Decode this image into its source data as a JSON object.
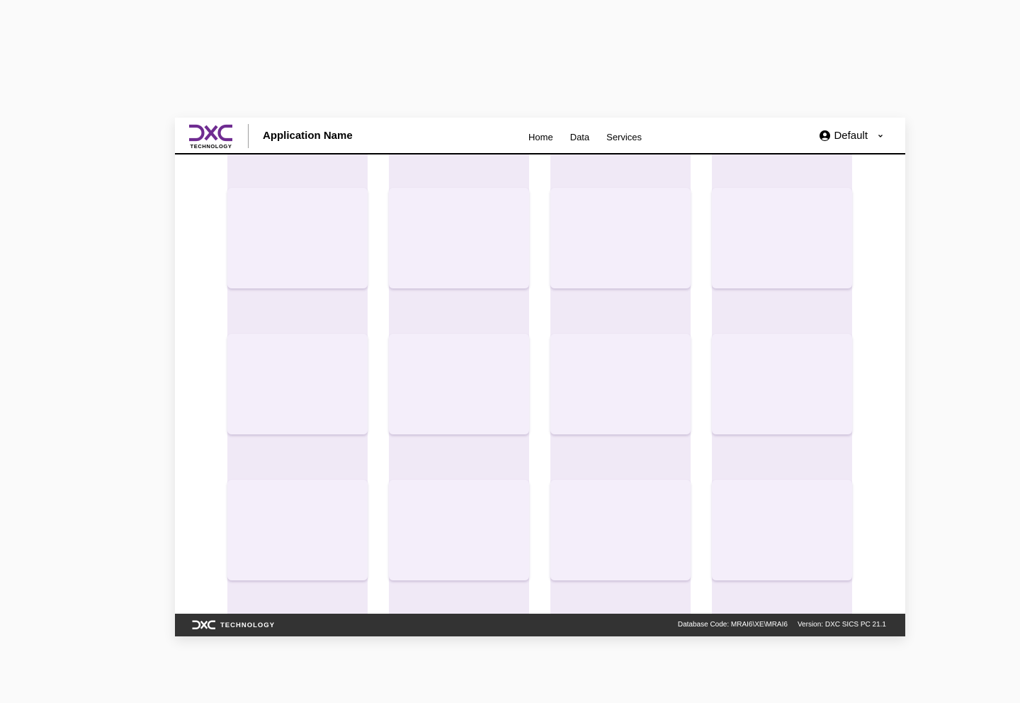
{
  "header": {
    "logo_text": "TECHNOLOGY",
    "app_name": "Application Name",
    "nav": [
      "Home",
      "Data",
      "Services"
    ],
    "user_label": "Default"
  },
  "footer": {
    "logo_text": "TECHNOLOGY",
    "database_code": "Database Code: MRAI6\\XE\\MRAI6",
    "version": "Version: DXC SICS PC 21.1"
  },
  "colors": {
    "brand_purple": "#6f2c91",
    "footer_bg": "#333333",
    "column_bg": "#f0e9f6",
    "card_bg": "#f4eefa"
  },
  "icons": {
    "user": "user-circle-icon",
    "dropdown": "chevron-down-icon"
  }
}
